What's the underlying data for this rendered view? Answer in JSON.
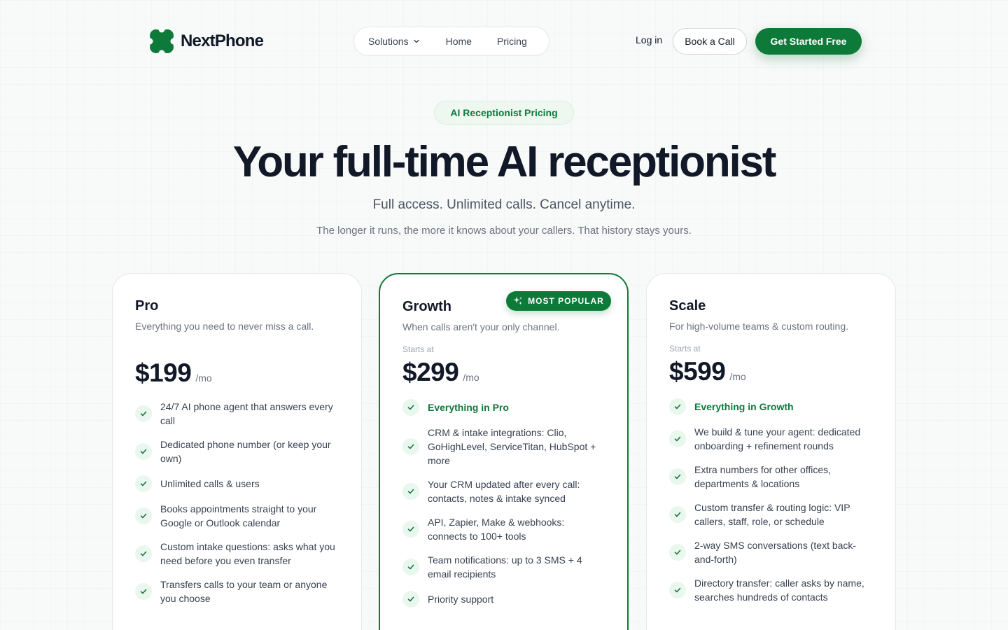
{
  "header": {
    "logo_text": "NextPhone",
    "nav": [
      {
        "label": "Solutions"
      },
      {
        "label": "Home"
      },
      {
        "label": "Pricing"
      }
    ],
    "login_label": "Log in",
    "book_call_label": "Book a Call",
    "get_started_label": "Get Started Free"
  },
  "hero": {
    "eyebrow": "AI Receptionist Pricing",
    "title": "Your full-time AI receptionist",
    "subtitle": "Full access. Unlimited calls. Cancel anytime.",
    "note": "The longer it runs, the more it knows about your callers. That history stays yours."
  },
  "plans": [
    {
      "name": "Pro",
      "description": "Everything you need to never miss a call.",
      "starts_at": "",
      "price": "$199",
      "period": "/mo",
      "features": [
        "24/7 AI phone agent that answers every call",
        "Dedicated phone number (or keep your own)",
        "Unlimited calls & users",
        "Books appointments straight to your Google or Outlook calendar",
        "Custom intake questions: asks what you need before you even transfer",
        "Transfers calls to your team or anyone you choose"
      ]
    },
    {
      "name": "Growth",
      "badge": "MOST POPULAR",
      "description": "When calls aren't your only channel.",
      "starts_at": "Starts at",
      "price": "$299",
      "period": "/mo",
      "highlight": "Everything in Pro",
      "features": [
        "CRM & intake integrations: Clio, GoHighLevel, ServiceTitan, HubSpot + more",
        "Your CRM updated after every call: contacts, notes & intake synced",
        "API, Zapier, Make & webhooks: connects to 100+ tools",
        "Team notifications: up to 3 SMS + 4 email recipients",
        "Priority support"
      ]
    },
    {
      "name": "Scale",
      "description": "For high-volume teams & custom routing.",
      "starts_at": "Starts at",
      "price": "$599",
      "period": "/mo",
      "highlight": "Everything in Growth",
      "features": [
        "We build & tune your agent: dedicated onboarding + refinement rounds",
        "Extra numbers for other offices, departments & locations",
        "Custom transfer & routing logic: VIP callers, staff, role, or schedule",
        "2-way SMS conversations (text back-and-forth)",
        "Directory transfer: caller asks by name, searches hundreds of contacts"
      ]
    }
  ],
  "colors": {
    "brand_green": "#0e7a3a",
    "text_dark": "#111827",
    "muted": "#6b7280"
  },
  "icons": {
    "logo": "clover-logo-icon",
    "solutions_caret": "chevron-down-icon",
    "feature": "check-icon",
    "badge": "sparkle-icon"
  }
}
